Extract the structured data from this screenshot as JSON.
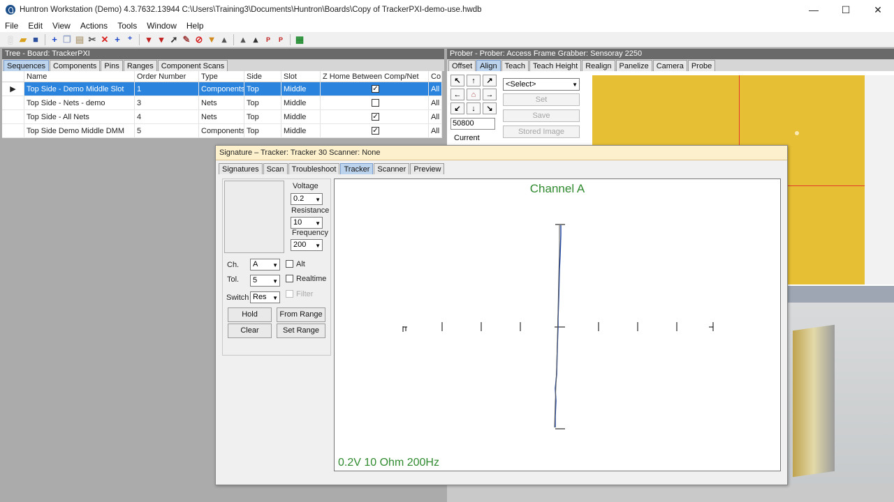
{
  "window": {
    "title": "Huntron Workstation (Demo) 4.3.7632.13944  C:\\Users\\Training3\\Documents\\Huntron\\Boards\\Copy of TrackerPXI-demo-use.hwdb",
    "minimize": "—",
    "maximize": "☐",
    "close": "✕"
  },
  "menu": [
    "File",
    "Edit",
    "View",
    "Actions",
    "Tools",
    "Window",
    "Help"
  ],
  "toolbar": {
    "icons": [
      "new-file-icon",
      "open-folder-icon",
      "save-icon",
      "add-icon",
      "copy-icon",
      "paste-icon",
      "cut-icon",
      "delete-icon",
      "add-item-icon",
      "add-multiple-icon",
      "probe-down-icon",
      "probe-add-icon",
      "probe-arrow-icon",
      "pin-icon",
      "stop-icon",
      "filter-icon",
      "probe-edit-icon",
      "probe-home-icon",
      "probe-move-icon",
      "pin-pin-icon",
      "pin-home-icon",
      "board-icon"
    ]
  },
  "tree": {
    "header": "Tree - Board: TrackerPXI",
    "tabs": [
      "Sequences",
      "Components",
      "Pins",
      "Ranges",
      "Component Scans"
    ],
    "columns": [
      "Name",
      "Order Number",
      "Type",
      "Side",
      "Slot",
      "Z Home Between Comp/Net",
      "Co"
    ],
    "rows": [
      {
        "name": "Top Side - Demo Middle Slot",
        "order": "1",
        "type": "Components",
        "side": "Top",
        "slot": "Middle",
        "zhome": "✓",
        "co": "All"
      },
      {
        "name": "Top Side - Nets - demo",
        "order": "3",
        "type": "Nets",
        "side": "Top",
        "slot": "Middle",
        "zhome": "",
        "co": "All"
      },
      {
        "name": "Top Side - All Nets",
        "order": "4",
        "type": "Nets",
        "side": "Top",
        "slot": "Middle",
        "zhome": "✓",
        "co": "All"
      },
      {
        "name": "Top Side Demo Middle DMM",
        "order": "5",
        "type": "Components",
        "side": "Top",
        "slot": "Middle",
        "zhome": "✓",
        "co": "All"
      }
    ]
  },
  "prober": {
    "header": "Prober - Prober: Access Frame Grabber: Sensoray 2250",
    "tabs": [
      "Offset",
      "Align",
      "Teach",
      "Teach Height",
      "Realign",
      "Panelize",
      "Camera",
      "Probe"
    ],
    "step_value": "50800",
    "current_label": "Current",
    "select_value": "<Select>",
    "buttons": [
      "Set",
      "Save",
      "Stored Image"
    ]
  },
  "signature": {
    "title": "Signature – Tracker: Tracker 30  Scanner: None",
    "tabs": [
      "Signatures",
      "Scan",
      "Troubleshoot",
      "Tracker",
      "Scanner",
      "Preview"
    ],
    "voltage_label": "Voltage",
    "voltage_value": "0.2",
    "resistance_label": "Resistance",
    "resistance_value": "10",
    "frequency_label": "Frequency",
    "frequency_value": "200",
    "ch_label": "Ch.",
    "ch_value": "A",
    "tol_label": "Tol.",
    "tol_value": "5",
    "switch_label": "Switch",
    "switch_value": "Res",
    "alt_label": "Alt",
    "realtime_label": "Realtime",
    "filter_label": "Filter",
    "hold_label": "Hold",
    "from_range_label": "From Range",
    "clear_label": "Clear",
    "set_range_label": "Set Range",
    "plot_title": "Channel A",
    "plot_footer": "0.2V 10 Ohm 200Hz"
  },
  "colors": {
    "selection": "#2a84de",
    "active_tab": "#bcd3ee",
    "trace": "#2b4fa8",
    "plot_text": "#2f8a2f",
    "camera": "#e6bf35",
    "crosshair": "#e23a2a"
  }
}
